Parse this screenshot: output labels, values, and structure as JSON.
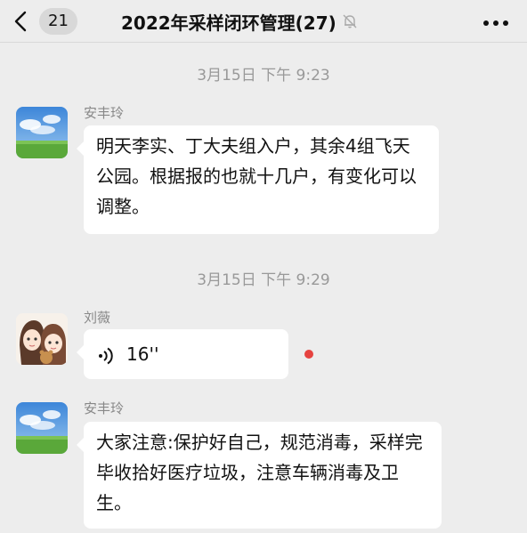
{
  "header": {
    "unread_count": "21",
    "title": "2022年采样闭环管理(27)"
  },
  "messages": [
    {
      "type": "time",
      "text": "3月15日 下午 9:23"
    },
    {
      "type": "text",
      "sender": "安丰玲",
      "text": "明天李实、丁大夫组入户，其余4组飞天公园。根据报的也就十几户，有变化可以调整。"
    },
    {
      "type": "time",
      "text": "3月15日 下午 9:29"
    },
    {
      "type": "voice",
      "sender": "刘薇",
      "duration": "16''",
      "unread": true
    },
    {
      "type": "text",
      "sender": "安丰玲",
      "text": "大家注意:保护好自己，规范消毒，采样完毕收拾好医疗垃圾，注意车辆消毒及卫生。"
    }
  ],
  "icons": [
    "back-chevron-icon",
    "mute-bell-icon",
    "more-dots-icon",
    "voice-wave-icon"
  ],
  "colors": {
    "background": "#ededed",
    "bubble": "#ffffff",
    "unread_dot": "#e64340",
    "timestamp": "#999999"
  }
}
